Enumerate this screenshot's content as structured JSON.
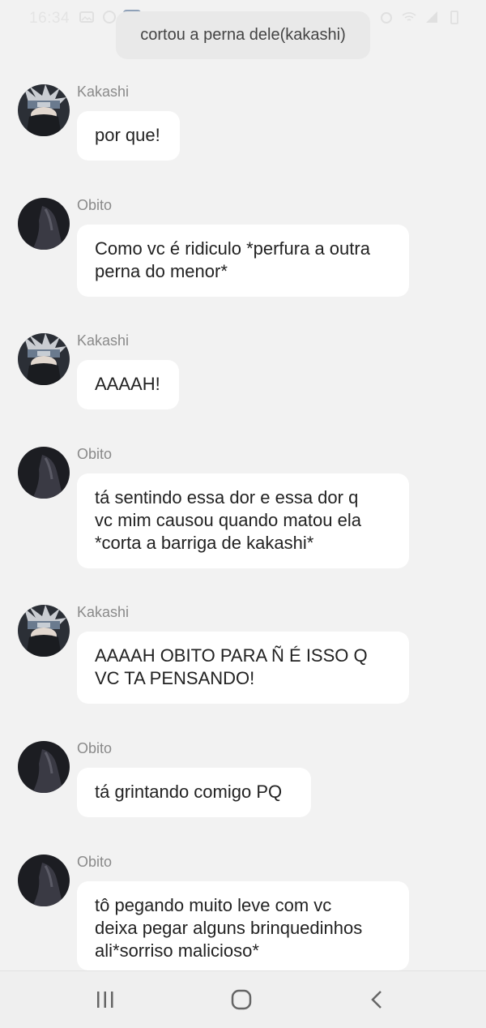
{
  "status_bar": {
    "time": "16:34",
    "icons_left": [
      "gallery-icon",
      "messenger-icon",
      "app-icon"
    ],
    "icons_right": [
      "alarm-icon",
      "wifi-icon",
      "signal-icon",
      "battery-icon"
    ]
  },
  "narration": "cortou a perna dele(kakashi)",
  "messages": [
    {
      "sender": "Kakashi",
      "avatar": "kakashi-avatar",
      "text": "por que!"
    },
    {
      "sender": "Obito",
      "avatar": "obito-avatar",
      "text": "Como vc é ridiculo *perfura a outra\nperna do menor*"
    },
    {
      "sender": "Kakashi",
      "avatar": "kakashi-avatar",
      "text": "AAAAH!"
    },
    {
      "sender": "Obito",
      "avatar": "obito-avatar",
      "text": "tá sentindo essa dor e essa dor q\nvc mim causou quando matou ela\n*corta a barriga de kakashi*"
    },
    {
      "sender": "Kakashi",
      "avatar": "kakashi-avatar",
      "text": "AAAAH OBITO PARA Ñ É ISSO Q\nVC TA PENSANDO!"
    },
    {
      "sender": "Obito",
      "avatar": "obito-avatar",
      "text": "tá grintando comigo PQ"
    },
    {
      "sender": "Obito",
      "avatar": "obito-avatar",
      "text": "tô pegando muito leve com vc\ndeixa pegar alguns brinquedinhos\nali*sorriso malicioso*"
    }
  ],
  "nav": [
    "recents-icon",
    "home-icon",
    "back-icon"
  ]
}
